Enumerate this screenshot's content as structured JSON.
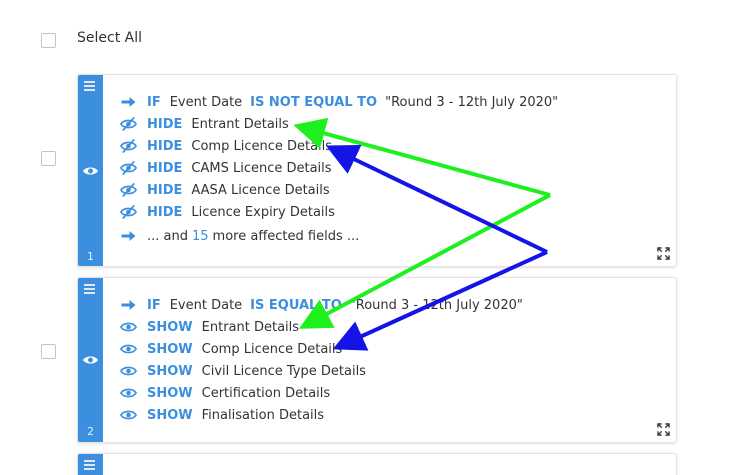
{
  "select_all_label": "Select All",
  "accent_color": "#3c8fde",
  "cards": [
    {
      "number": "1",
      "lines": [
        {
          "icon": "arrow-right-icon",
          "keyword": "IF",
          "field": "Event Date",
          "operator": "IS NOT EQUAL TO",
          "value": "\"Round 3 - 12th July 2020\""
        },
        {
          "icon": "eye-slash-icon",
          "keyword": "HIDE",
          "field": "Entrant Details"
        },
        {
          "icon": "eye-slash-icon",
          "keyword": "HIDE",
          "field": "Comp Licence Details"
        },
        {
          "icon": "eye-slash-icon",
          "keyword": "HIDE",
          "field": "CAMS Licence Details"
        },
        {
          "icon": "eye-slash-icon",
          "keyword": "HIDE",
          "field": "AASA Licence Details"
        },
        {
          "icon": "eye-slash-icon",
          "keyword": "HIDE",
          "field": "Licence Expiry Details"
        },
        {
          "icon": "arrow-right-icon",
          "more_prefix": "... and",
          "more_count": "15",
          "more_suffix": "more affected fields ..."
        }
      ]
    },
    {
      "number": "2",
      "lines": [
        {
          "icon": "arrow-right-icon",
          "keyword": "IF",
          "field": "Event Date",
          "operator": "IS EQUAL TO",
          "value": "\"Round 3 - 12th July 2020\""
        },
        {
          "icon": "eye-icon",
          "keyword": "SHOW",
          "field": "Entrant Details"
        },
        {
          "icon": "eye-icon",
          "keyword": "SHOW",
          "field": "Comp Licence Details"
        },
        {
          "icon": "eye-icon",
          "keyword": "SHOW",
          "field": "Civil Licence Type Details"
        },
        {
          "icon": "eye-icon",
          "keyword": "SHOW",
          "field": "Certification Details"
        },
        {
          "icon": "eye-icon",
          "keyword": "SHOW",
          "field": "Finalisation Details"
        }
      ]
    }
  ],
  "annotation_colors": {
    "green": "#1ef01e",
    "blue": "#1414e6"
  }
}
